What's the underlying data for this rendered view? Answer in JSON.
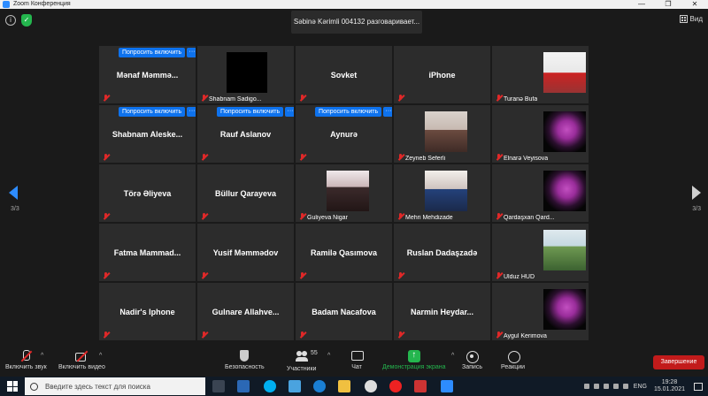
{
  "window": {
    "title": "Zoom Конференция",
    "controls": [
      "—",
      "❐",
      "✕"
    ]
  },
  "topbar": {
    "speaking": "Səbinə Kərimli 004132 разговаривает...",
    "view_label": "Вид"
  },
  "gallery": {
    "ask_label": "Попросить включить",
    "more_label": "···",
    "page_left": "3/3",
    "page_right": "3/3",
    "tiles": [
      {
        "id": "t1",
        "name": "Mənaf  Məmmə...",
        "label": "",
        "ask": true
      },
      {
        "id": "t2",
        "name": "",
        "label": "Shabnam Sadigo...",
        "ask": false
      },
      {
        "id": "t3",
        "name": "Sovket",
        "label": "",
        "ask": false
      },
      {
        "id": "t4",
        "name": "iPhone",
        "label": "",
        "ask": false
      },
      {
        "id": "t5",
        "name": "",
        "label": "Turanə Bufa",
        "ask": false
      },
      {
        "id": "t6",
        "name": "Shabnam  Aleske...",
        "label": "",
        "ask": true
      },
      {
        "id": "t7",
        "name": "Rauf Aslanov",
        "label": "",
        "ask": true
      },
      {
        "id": "t8",
        "name": "Aynurə",
        "label": "",
        "ask": true
      },
      {
        "id": "t9",
        "name": "",
        "label": "Zeyneb Seferli",
        "ask": false
      },
      {
        "id": "t10",
        "name": "",
        "label": "Elnarə Veyisova",
        "ask": false
      },
      {
        "id": "t11",
        "name": "Törə Əliyeva",
        "label": "",
        "ask": false
      },
      {
        "id": "t12",
        "name": "Büllur Qarayeva",
        "label": "",
        "ask": false
      },
      {
        "id": "t13",
        "name": "",
        "label": "Guliyeva Nigar",
        "ask": false
      },
      {
        "id": "t14",
        "name": "",
        "label": "Mehri Mehdizade",
        "ask": false
      },
      {
        "id": "t15",
        "name": "",
        "label": "Qardaşxan Qard...",
        "ask": false
      },
      {
        "id": "t16",
        "name": "Fatma  Mammad...",
        "label": "",
        "ask": false
      },
      {
        "id": "t17",
        "name": "Yusif Məmmədov",
        "label": "",
        "ask": false
      },
      {
        "id": "t18",
        "name": "Ramilə Qasımova",
        "label": "",
        "ask": false
      },
      {
        "id": "t19",
        "name": "Ruslan Dadaşzadə",
        "label": "",
        "ask": false
      },
      {
        "id": "t20",
        "name": "",
        "label": "Ulduz HUD",
        "ask": false
      },
      {
        "id": "t21",
        "name": "Nadir's Iphone",
        "label": "",
        "ask": false
      },
      {
        "id": "t22",
        "name": "Gulnare  Allahve...",
        "label": "",
        "ask": false
      },
      {
        "id": "t23",
        "name": "Badam Nacafova",
        "label": "",
        "ask": false
      },
      {
        "id": "t24",
        "name": "Narmin  Heydar...",
        "label": "",
        "ask": false
      },
      {
        "id": "t25",
        "name": "",
        "label": "Aygul Kerimova",
        "ask": false
      }
    ]
  },
  "toolbar": {
    "unmute": "Включить звук",
    "start_video": "Включить видео",
    "security": "Безопасность",
    "participants": "Участники",
    "participants_count": "55",
    "chat": "Чат",
    "share_screen": "Демонстрация экрана",
    "record": "Запись",
    "reactions": "Реакции",
    "end": "Завершение",
    "caret": "^"
  },
  "taskbar": {
    "search_placeholder": "Введите здесь текст для поиска",
    "lang": "ENG",
    "time": "19:28",
    "date": "15.01.2021"
  }
}
